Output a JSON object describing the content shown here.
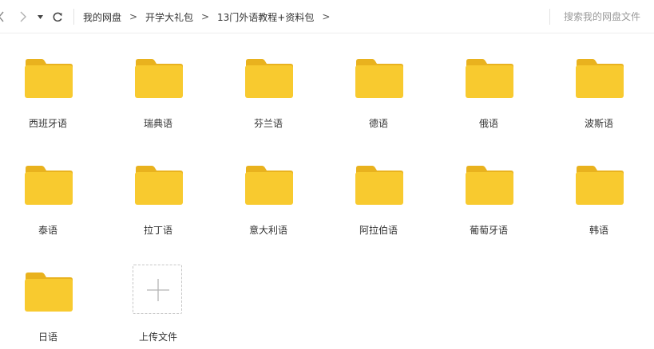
{
  "toolbar": {
    "back_icon": "chevron-left-icon",
    "forward_icon": "chevron-right-icon",
    "history_icon": "caret-down-icon",
    "refresh_icon": "refresh-icon"
  },
  "breadcrumb": {
    "items": [
      "我的网盘",
      "开学大礼包",
      "13门外语教程+资料包"
    ],
    "separator": ">"
  },
  "search": {
    "placeholder": "搜索我的网盘文件",
    "value": ""
  },
  "folders": [
    {
      "name": "西班牙语"
    },
    {
      "name": "瑞典语"
    },
    {
      "name": "芬兰语"
    },
    {
      "name": "德语"
    },
    {
      "name": "俄语"
    },
    {
      "name": "波斯语"
    },
    {
      "name": "泰语"
    },
    {
      "name": "拉丁语"
    },
    {
      "name": "意大利语"
    },
    {
      "name": "阿拉伯语"
    },
    {
      "name": "葡萄牙语"
    },
    {
      "name": "韩语"
    },
    {
      "name": "日语"
    }
  ],
  "upload": {
    "label": "上传文件",
    "icon": "plus-icon"
  },
  "colors": {
    "folder_front": "#F8CA2F",
    "folder_back": "#E9B21E",
    "breadcrumb_text": "#333333",
    "placeholder": "#9A9A9A"
  }
}
